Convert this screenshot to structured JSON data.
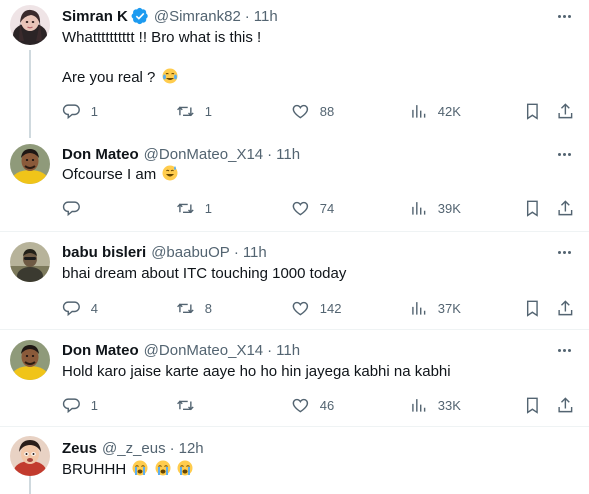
{
  "tweets": [
    {
      "name": "Simran K",
      "verified": true,
      "handle": "@Simrank82",
      "dot": "·",
      "time": "11h",
      "lines": [
        "Whatttttttttt !! Bro what is this !",
        "Are you real ?"
      ],
      "line_emojis": [
        [],
        [
          "joy"
        ]
      ],
      "reply": "1",
      "retweet": "1",
      "like": "88",
      "views": "42K",
      "avatar": "simran-avatar"
    },
    {
      "name": "Don Mateo",
      "verified": false,
      "handle": "@DonMateo_X14",
      "dot": "·",
      "time": "11h",
      "lines": [
        "Ofcourse I am"
      ],
      "line_emojis": [
        [
          "sweat-smile"
        ]
      ],
      "reply": "",
      "retweet": "1",
      "like": "74",
      "views": "39K",
      "avatar": "don-mateo-avatar"
    },
    {
      "name": "babu bisleri",
      "verified": false,
      "handle": "@baabuOP",
      "dot": "·",
      "time": "11h",
      "lines": [
        "bhai dream about ITC touching 1000 today"
      ],
      "line_emojis": [
        []
      ],
      "reply": "4",
      "retweet": "8",
      "like": "142",
      "views": "37K",
      "avatar": "babu-avatar"
    },
    {
      "name": "Don Mateo",
      "verified": false,
      "handle": "@DonMateo_X14",
      "dot": "·",
      "time": "11h",
      "lines": [
        "Hold karo jaise karte aaye ho ho hin jayega kabhi na kabhi"
      ],
      "line_emojis": [
        []
      ],
      "reply": "1",
      "retweet": "",
      "like": "46",
      "views": "33K",
      "avatar": "don-mateo-avatar"
    },
    {
      "name": "Zeus",
      "verified": false,
      "handle": "@_z_eus",
      "dot": "·",
      "time": "12h",
      "lines": [
        "BRUHHH"
      ],
      "line_emojis": [
        [
          "loudly-crying",
          "loudly-crying",
          "loudly-crying"
        ]
      ],
      "avatar": "zeus-avatar"
    }
  ],
  "colors": {
    "text": "#0f1419",
    "secondary": "#536471",
    "verified": "#1d9bf0",
    "divider": "#eff3f4",
    "thread_line": "#cfd9de"
  }
}
